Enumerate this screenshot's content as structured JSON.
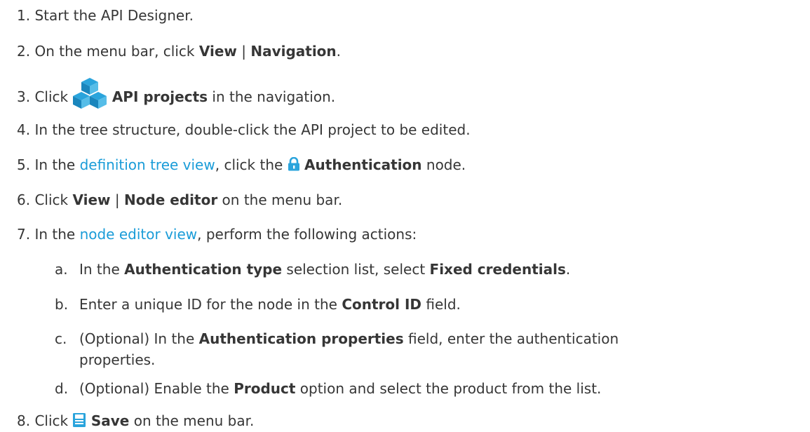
{
  "steps": [
    {
      "num": "1.",
      "text": "Start the API Designer."
    },
    {
      "num": "2.",
      "pre": "On the menu bar, click ",
      "b1": "View",
      "sep": " | ",
      "b2": "Navigation",
      "post": "."
    },
    {
      "num": "3.",
      "pre": "Click ",
      "icon": "api-projects-cubes-icon",
      "b1": "API projects",
      "post": " in the navigation."
    },
    {
      "num": "4.",
      "text": "In the tree structure, double-click the API project to be edited."
    },
    {
      "num": "5.",
      "pre": "In the ",
      "link": "definition tree view",
      "mid": ", click the ",
      "icon": "lock-icon",
      "b1": "Authentication",
      "post": " node."
    },
    {
      "num": "6.",
      "pre": "Click ",
      "b1": "View",
      "sep": " | ",
      "b2": "Node editor",
      "post": " on the menu bar."
    },
    {
      "num": "7.",
      "pre": "In the ",
      "link": "node editor view",
      "post": ", perform the following actions:"
    },
    {
      "num": "8.",
      "pre": "Click ",
      "icon": "save-disk-icon",
      "b1": "Save",
      "post": " on the menu bar."
    }
  ],
  "substeps": [
    {
      "num": "a.",
      "pre": "In the ",
      "b1": "Authentication type",
      "mid": " selection list, select ",
      "b2": "Fixed credentials",
      "post": "."
    },
    {
      "num": "b.",
      "pre": "Enter a unique ID for the node in the ",
      "b1": "Control ID",
      "post": " field."
    },
    {
      "num": "c.",
      "pre": "(Optional) In the ",
      "b1": "Authentication properties",
      "post": " field, enter the authentication",
      "cont": "properties."
    },
    {
      "num": "d.",
      "pre": "(Optional) Enable the ",
      "b1": "Product",
      "post": " option and select the product from the list."
    }
  ],
  "colors": {
    "text": "#363636",
    "link": "#1a9cd8",
    "icon": "#2aa4dc"
  }
}
